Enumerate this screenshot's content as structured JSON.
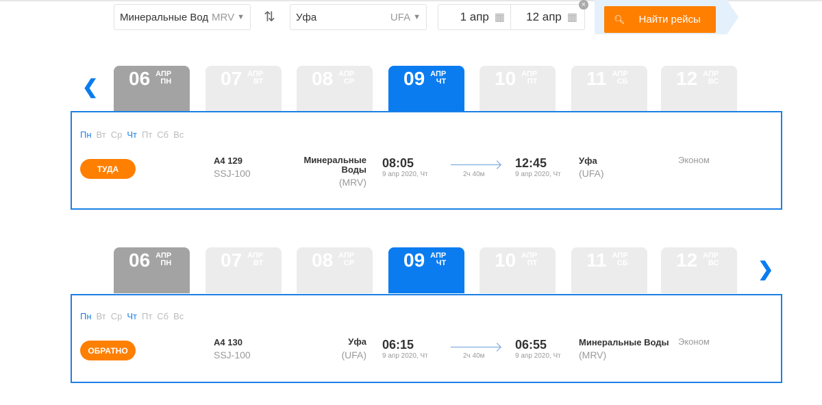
{
  "search": {
    "from": "Минеральные Вод",
    "from_code": "MRV",
    "to": "Уфа",
    "to_code": "UFA",
    "date_out": "1 апр",
    "date_back": "12 апр",
    "button": "Найти рейсы"
  },
  "colors": {
    "accent": "#0a7cf0",
    "orange": "#ff7f00"
  },
  "dates": [
    {
      "num": "06",
      "month": "АПР",
      "wd": "ПН",
      "state": "selected"
    },
    {
      "num": "07",
      "month": "АПР",
      "wd": "ВТ",
      "state": "inactive"
    },
    {
      "num": "08",
      "month": "АПР",
      "wd": "СР",
      "state": "inactive"
    },
    {
      "num": "09",
      "month": "АПР",
      "wd": "ЧТ",
      "state": "active"
    },
    {
      "num": "10",
      "month": "АПР",
      "wd": "ПТ",
      "state": "inactive"
    },
    {
      "num": "11",
      "month": "АПР",
      "wd": "СБ",
      "state": "inactive"
    },
    {
      "num": "12",
      "month": "АПР",
      "wd": "ВС",
      "state": "inactive"
    }
  ],
  "weekdays": [
    {
      "l": "Пн",
      "on": true
    },
    {
      "l": "Вт",
      "on": false
    },
    {
      "l": "Ср",
      "on": false
    },
    {
      "l": "Чт",
      "on": true
    },
    {
      "l": "Пт",
      "on": false
    },
    {
      "l": "Сб",
      "on": false
    },
    {
      "l": "Вс",
      "on": false
    }
  ],
  "flights": [
    {
      "dir": "ТУДА",
      "flight": "А4 129",
      "aircraft": "SSJ-100",
      "dep_city": "Минеральные Воды",
      "dep_code": "(MRV)",
      "dep_time": "08:05",
      "dep_date": "9 апр 2020, Чт",
      "duration": "2ч 40м",
      "arr_time": "12:45",
      "arr_date": "9 апр 2020, Чт",
      "arr_city": "Уфа",
      "arr_code": "(UFA)",
      "class": "Эконом"
    },
    {
      "dir": "ОБРАТНО",
      "flight": "А4 130",
      "aircraft": "SSJ-100",
      "dep_city": "Уфа",
      "dep_code": "(UFA)",
      "dep_time": "06:15",
      "dep_date": "9 апр 2020, Чт",
      "duration": "2ч 40м",
      "arr_time": "06:55",
      "arr_date": "9 апр 2020, Чт",
      "arr_city": "Минеральные Воды",
      "arr_code": "(MRV)",
      "class": "Эконом"
    }
  ],
  "nav": {
    "prev": "❮",
    "next": "❯"
  }
}
